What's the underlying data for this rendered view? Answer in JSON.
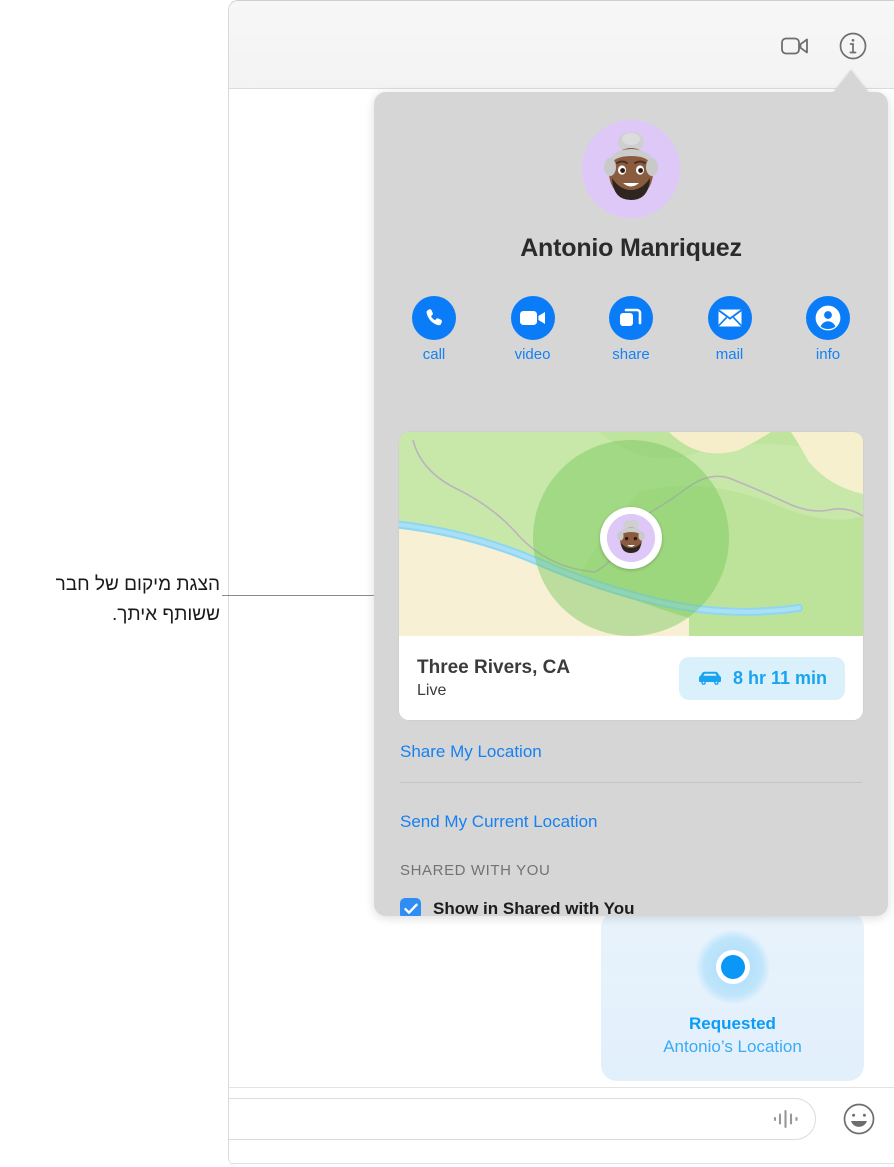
{
  "window": {
    "toolbar": {
      "facetime_icon": "video-camera-icon",
      "info_icon": "info-circle-icon"
    }
  },
  "popover": {
    "contact_name": "Antonio Manriquez",
    "avatar_icon": "memoji-avatar",
    "actions": [
      {
        "label": "call",
        "icon": "phone-icon"
      },
      {
        "label": "video",
        "icon": "video-camera-icon"
      },
      {
        "label": "share",
        "icon": "windows-share-icon"
      },
      {
        "label": "mail",
        "icon": "envelope-icon"
      },
      {
        "label": "info",
        "icon": "person-circle-icon"
      }
    ],
    "map": {
      "place": "Three Rivers, CA",
      "status": "Live",
      "eta": "8 hr 11 min",
      "eta_icon": "car-icon",
      "pin_icon": "memoji-map-pin"
    },
    "links": {
      "share_my_location": "Share My Location",
      "send_my_current_location": "Send My Current Location"
    },
    "section_header": "SHARED WITH YOU",
    "shared_with_you_label": "Show in Shared with You",
    "shared_with_you_checked": true
  },
  "conversation": {
    "bubble": {
      "title": "Requested",
      "subtitle": "Antonio’s Location",
      "icon": "location-dot-icon"
    }
  },
  "input_bar": {
    "value": "",
    "placeholder": "",
    "audio_icon": "audio-waveform-icon",
    "emoji_icon": "smiley-face-icon"
  },
  "callout": {
    "text": "הצגת מיקום של חבר ששותף איתך."
  },
  "colors": {
    "accent_blue": "#0a7cf7",
    "link_blue": "#1581f3",
    "popover_gray": "#d6d6d6",
    "bubble_blue": "#e4f1fb",
    "map_green": "#c4e6a3"
  }
}
